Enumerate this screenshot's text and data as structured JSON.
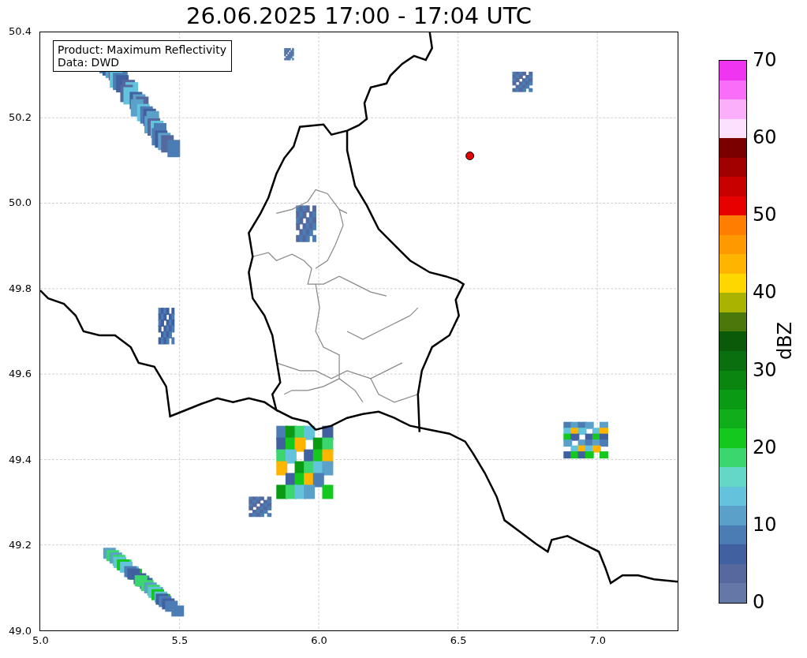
{
  "title": "26.06.2025 17:00 - 17:04 UTC",
  "map": {
    "info_box": [
      "Product: Maximum Reflectivity",
      "Data: DWD"
    ],
    "y_ticks": [
      "50.4",
      "50.2",
      "50.0",
      "49.8",
      "49.6",
      "49.4",
      "49.2",
      "49.0"
    ],
    "x_ticks": [
      "5.0",
      "5.5",
      "6.0",
      "6.5",
      "7.0"
    ]
  },
  "colorbar": {
    "label": "dBZ",
    "ticks": [
      "70",
      "60",
      "50",
      "40",
      "30",
      "20",
      "10",
      "0"
    ],
    "segments": [
      {
        "color": "#f035f0"
      },
      {
        "color": "#f96ef9"
      },
      {
        "color": "#fbaffb"
      },
      {
        "color": "#fde0fd"
      },
      {
        "color": "#7a0000"
      },
      {
        "color": "#a00000"
      },
      {
        "color": "#c80000"
      },
      {
        "color": "#e60000"
      },
      {
        "color": "#ff7d00"
      },
      {
        "color": "#ff9900"
      },
      {
        "color": "#ffb400"
      },
      {
        "color": "#ffd700"
      },
      {
        "color": "#aab400"
      },
      {
        "color": "#4a780a"
      },
      {
        "color": "#0a5a0a"
      },
      {
        "color": "#0a700f"
      },
      {
        "color": "#0a850f"
      },
      {
        "color": "#0a9a14"
      },
      {
        "color": "#0fae1a"
      },
      {
        "color": "#14c81e"
      },
      {
        "color": "#3cd66e"
      },
      {
        "color": "#64d7c8"
      },
      {
        "color": "#64c3dc"
      },
      {
        "color": "#5aa0c8"
      },
      {
        "color": "#4b7db4"
      },
      {
        "color": "#4160a0"
      },
      {
        "color": "#55699e"
      },
      {
        "color": "#6478a8"
      }
    ]
  }
}
